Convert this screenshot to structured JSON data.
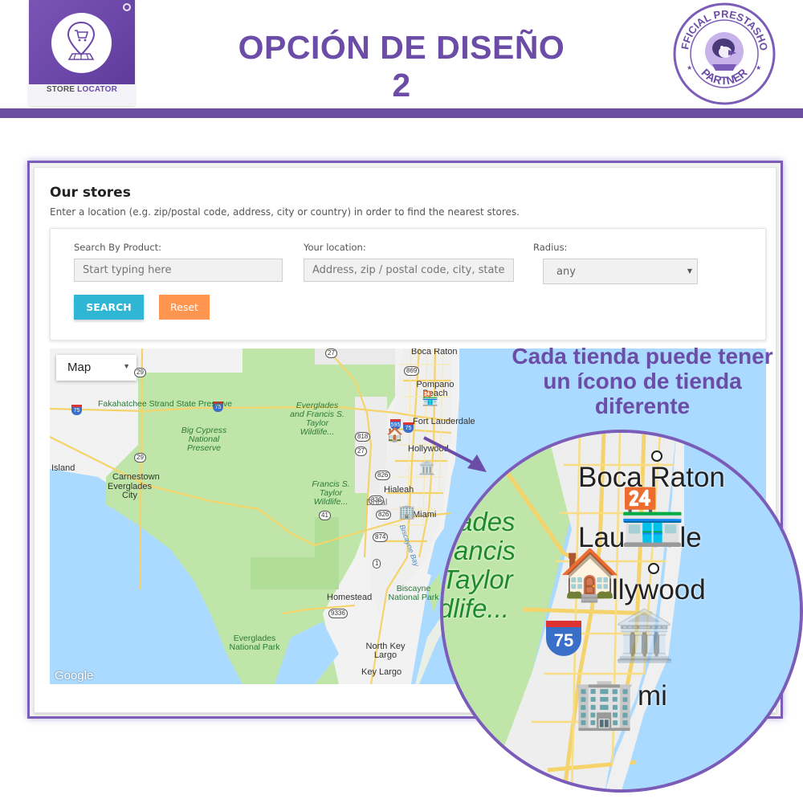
{
  "header": {
    "logo": {
      "caption_primary": "STORE",
      "caption_accent": "LOCATOR",
      "icon": "cart-location-pin-icon"
    },
    "title": "OPCIÓN DE DISEÑO 2",
    "badge": {
      "top_text": "OFFICIAL PRESTASHOP",
      "bottom_text": "PARTNER",
      "icon": "puffin-mascot-icon"
    }
  },
  "colors": {
    "brand_purple": "#6b4ca6",
    "search_button": "#2eb6d4",
    "reset_button": "#ff954e",
    "water": "#aadaff",
    "park": "#bfe6a8"
  },
  "store_locator": {
    "title": "Our stores",
    "description": "Enter a location (e.g. zip/postal code, address, city or country) in order to find the nearest stores.",
    "search_by_product": {
      "label": "Search By Product:",
      "placeholder": "Start typing here",
      "value": ""
    },
    "your_location": {
      "label": "Your location:",
      "placeholder": "Address, zip / postal code, city, state or country",
      "value": ""
    },
    "radius": {
      "label": "Radius:",
      "selected": "any"
    },
    "buttons": {
      "search": "SEARCH",
      "reset": "Reset"
    }
  },
  "map": {
    "type_selector": "Map",
    "attribution": "Google",
    "parks": [
      "Fakahatchee Strand State Preserve",
      "Big Cypress National Preserve",
      "Everglades and Francis S. Taylor Wildlife...",
      "Francis S. Taylor Wildlife...",
      "Everglades National Park",
      "Biscayne National Park"
    ],
    "places": [
      "Island",
      "Carnestown",
      "Everglades City",
      "Boca Raton",
      "Pompano Beach",
      "Fort Lauderdale",
      "Hollywood",
      "Hialeah",
      "Doral",
      "Miami",
      "Homestead",
      "North Key Largo",
      "Key Largo"
    ],
    "water_labels": [
      "Biscayne Bay"
    ],
    "routes": [
      "27",
      "29",
      "29",
      "75",
      "75",
      "75",
      "869",
      "595",
      "818",
      "27",
      "826",
      "41",
      "836",
      "874",
      "826",
      "1",
      "9336"
    ],
    "store_markers": [
      {
        "name": "Fort Lauderdale store",
        "icon": "storefront-awning-icon"
      },
      {
        "name": "Hollywood store",
        "icon": "house-icon"
      },
      {
        "name": "Hialeah store",
        "icon": "bank-building-icon"
      },
      {
        "name": "Miami store",
        "icon": "office-building-icon"
      }
    ]
  },
  "callout": {
    "text": "Cada tienda puede tener un ícono de tienda diferente"
  },
  "magnifier": {
    "labels": {
      "boca": "Boca Raton",
      "lauderdale": "Lau   dale",
      "hollywood": "llywood",
      "miami": "mi",
      "park1": "ades",
      "park2": "rancis",
      "park3": "Taylor",
      "park4": "dlife...",
      "i75": "75"
    }
  }
}
